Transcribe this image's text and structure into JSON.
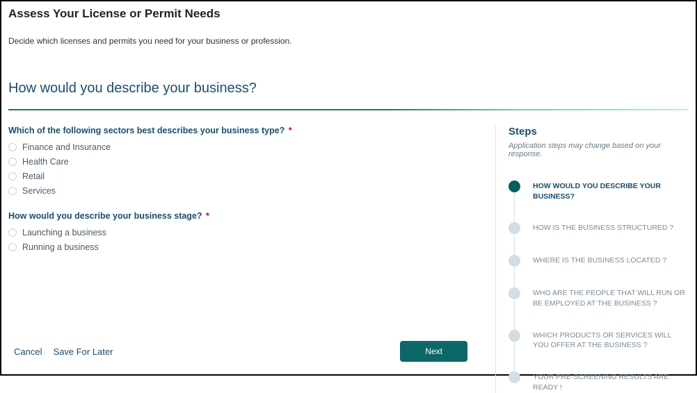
{
  "header": {
    "title": "Assess Your License or Permit Needs",
    "subtitle": "Decide which licenses and permits you need for your business or profession."
  },
  "section": {
    "heading": "How would you describe your business?"
  },
  "questions": {
    "q1": {
      "label": "Which of the following sectors best describes your business type?",
      "options": [
        "Finance and Insurance",
        "Health Care",
        "Retail",
        "Services"
      ]
    },
    "q2": {
      "label": "How would you describe your business stage?",
      "options": [
        "Launching a business",
        "Running a business"
      ]
    }
  },
  "footer": {
    "cancel": "Cancel",
    "save": "Save For Later",
    "next": "Next"
  },
  "steps": {
    "title": "Steps",
    "note": "Application steps may change based on your response.",
    "items": [
      {
        "label": "HOW WOULD YOU DESCRIBE YOUR BUSINESS?",
        "active": true
      },
      {
        "label": "HOW IS THE BUSINESS STRUCTURED ?",
        "active": false
      },
      {
        "label": "WHERE IS THE BUSINESS LOCATED ?",
        "active": false
      },
      {
        "label": "WHO ARE THE PEOPLE THAT WILL RUN OR BE EMPLOYED AT THE BUSINESS ?",
        "active": false
      },
      {
        "label": "WHICH PRODUCTS OR SERVICES WILL YOU OFFER AT THE BUSINESS ?",
        "active": false
      },
      {
        "label": "YOUR PRE-SCREENING RESULTS ARE READY !",
        "active": false
      }
    ]
  }
}
